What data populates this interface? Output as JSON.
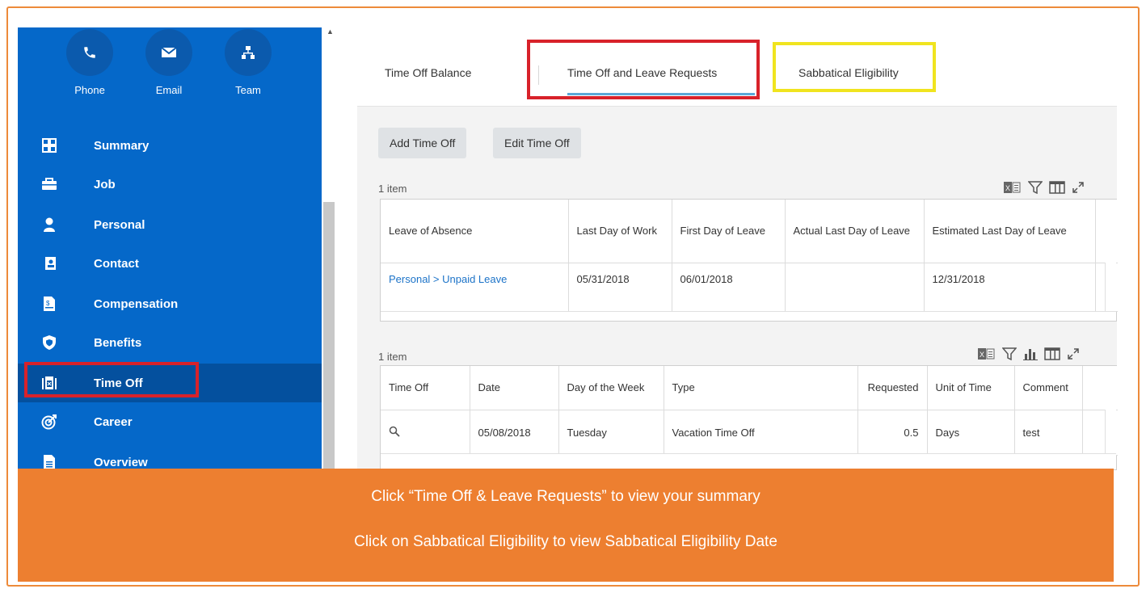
{
  "quick_actions": [
    {
      "label": "Phone",
      "icon": "phone-icon"
    },
    {
      "label": "Email",
      "icon": "email-icon"
    },
    {
      "label": "Team",
      "icon": "team-icon"
    }
  ],
  "nav": [
    {
      "label": "Summary",
      "icon": "summary-icon"
    },
    {
      "label": "Job",
      "icon": "briefcase-icon"
    },
    {
      "label": "Personal",
      "icon": "person-icon"
    },
    {
      "label": "Contact",
      "icon": "contact-card-icon"
    },
    {
      "label": "Compensation",
      "icon": "document-money-icon"
    },
    {
      "label": "Benefits",
      "icon": "shield-icon"
    },
    {
      "label": "Time Off",
      "icon": "calendar-bag-icon",
      "active": true
    },
    {
      "label": "Career",
      "icon": "target-icon"
    },
    {
      "label": "Overview",
      "icon": "document-icon"
    }
  ],
  "tabs": {
    "balance": "Time Off Balance",
    "requests": "Time Off and Leave Requests",
    "sabbatical": "Sabbatical Eligibility",
    "active": "requests"
  },
  "actions": {
    "add": "Add Time Off",
    "edit": "Edit Time Off"
  },
  "leave_table": {
    "count": "1 item",
    "headers": [
      "Leave of Absence",
      "Last Day of Work",
      "First Day of Leave",
      "Actual Last Day of Leave",
      "Estimated Last Day of Leave"
    ],
    "rows": [
      [
        "Personal > Unpaid Leave",
        "05/31/2018",
        "06/01/2018",
        "",
        "12/31/2018"
      ]
    ]
  },
  "timeoff_table": {
    "count": "1 item",
    "headers": [
      "Time Off",
      "Date",
      "Day of the Week",
      "Type",
      "Requested",
      "Unit of Time",
      "Comment"
    ],
    "rows": [
      [
        "",
        "05/08/2018",
        "Tuesday",
        "Vacation Time Off",
        "0.5",
        "Days",
        "test"
      ]
    ]
  },
  "banner": {
    "line1": "Click “Time Off & Leave Requests” to view your summary",
    "line2": "Click on Sabbatical Eligibility to view Sabbatical Eligibility Date"
  },
  "colors": {
    "sidebar": "#0568c9",
    "sidebar_active": "#04509e",
    "banner": "#ed7f30",
    "highlight_red": "#d8222a",
    "highlight_yellow": "#f0e41f",
    "link": "#1c73c8"
  }
}
